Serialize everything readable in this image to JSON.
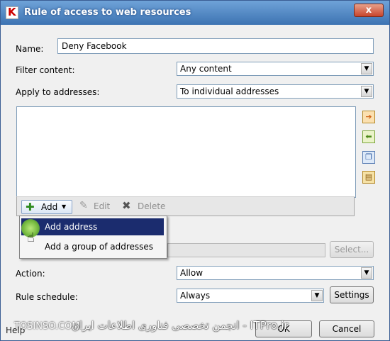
{
  "window": {
    "title": "Rule of access to web resources",
    "close": "x"
  },
  "form": {
    "name_label": "Name:",
    "name_value": "Deny Facebook",
    "filter_label": "Filter content:",
    "filter_value": "Any content",
    "apply_label": "Apply to addresses:",
    "apply_value": "To individual addresses"
  },
  "toolbar": {
    "add": "Add",
    "edit": "Edit",
    "delete": "Delete"
  },
  "menu": {
    "items": [
      "Add address",
      "Add a group of addresses"
    ]
  },
  "select_button": "Select...",
  "action": {
    "label": "Action:",
    "value": "Allow"
  },
  "schedule": {
    "label": "Rule schedule:",
    "value": "Always",
    "settings": "Settings"
  },
  "footer": {
    "help": "Help",
    "ok": "OK",
    "cancel": "Cancel"
  },
  "watermark": {
    "text": "انجمن تخصصی فناوری اطلاعات ایران - ITPro.ir",
    "site": "TOSINSO.COM"
  }
}
